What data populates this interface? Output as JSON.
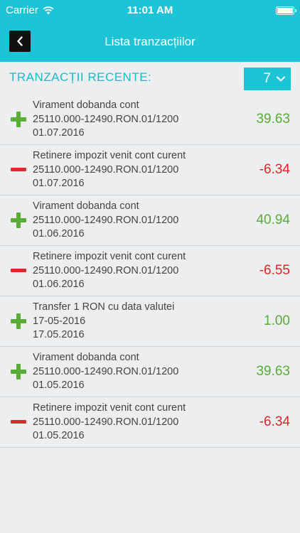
{
  "status_bar": {
    "carrier": "Carrier",
    "time": "11:01 AM"
  },
  "nav": {
    "title": "Lista tranzacțiilor"
  },
  "filter": {
    "label": "TRANZACȚII RECENTE:",
    "selected": "7"
  },
  "colors": {
    "accent": "#1cc4d6",
    "positive": "#5bab37",
    "negative": "#e02424"
  },
  "transactions": [
    {
      "sign": "plus",
      "line1": "Virament dobanda cont",
      "line2": "25110.000-12490.RON.01/1200",
      "line3": "01.07.2016",
      "amount": "39.63"
    },
    {
      "sign": "minus",
      "line1": "Retinere impozit venit cont curent",
      "line2": "25110.000-12490.RON.01/1200",
      "line3": "01.07.2016",
      "amount": "-6.34"
    },
    {
      "sign": "plus",
      "line1": "Virament dobanda cont",
      "line2": "25110.000-12490.RON.01/1200",
      "line3": "01.06.2016",
      "amount": "40.94"
    },
    {
      "sign": "minus",
      "line1": "Retinere impozit venit cont curent",
      "line2": "25110.000-12490.RON.01/1200",
      "line3": "01.06.2016",
      "amount": "-6.55"
    },
    {
      "sign": "plus",
      "line1": "Transfer 1 RON cu data valutei",
      "line2": "17-05-2016",
      "line3": "17.05.2016",
      "amount": "1.00"
    },
    {
      "sign": "plus",
      "line1": "Virament dobanda cont",
      "line2": "25110.000-12490.RON.01/1200",
      "line3": "01.05.2016",
      "amount": "39.63"
    },
    {
      "sign": "minus",
      "line1": "Retinere impozit venit cont curent",
      "line2": "25110.000-12490.RON.01/1200",
      "line3": "01.05.2016",
      "amount": "-6.34"
    }
  ]
}
